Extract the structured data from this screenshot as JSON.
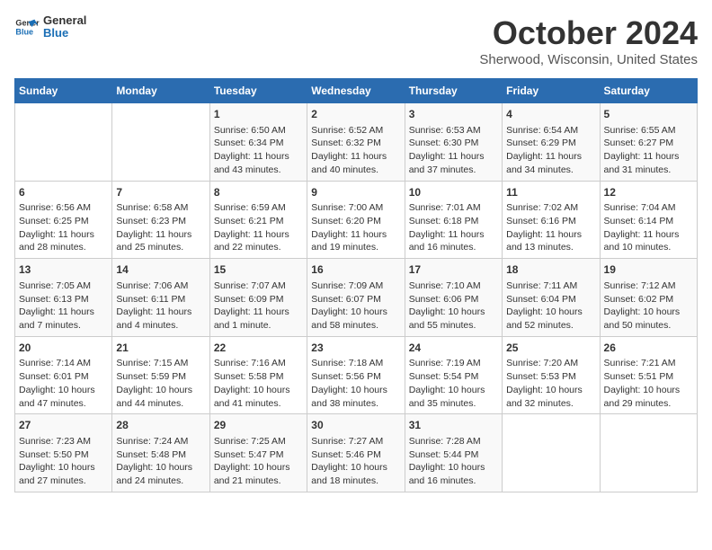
{
  "header": {
    "logo_line1": "General",
    "logo_line2": "Blue",
    "month": "October 2024",
    "location": "Sherwood, Wisconsin, United States"
  },
  "weekdays": [
    "Sunday",
    "Monday",
    "Tuesday",
    "Wednesday",
    "Thursday",
    "Friday",
    "Saturday"
  ],
  "weeks": [
    [
      {
        "day": "",
        "info": ""
      },
      {
        "day": "",
        "info": ""
      },
      {
        "day": "1",
        "info": "Sunrise: 6:50 AM\nSunset: 6:34 PM\nDaylight: 11 hours and 43 minutes."
      },
      {
        "day": "2",
        "info": "Sunrise: 6:52 AM\nSunset: 6:32 PM\nDaylight: 11 hours and 40 minutes."
      },
      {
        "day": "3",
        "info": "Sunrise: 6:53 AM\nSunset: 6:30 PM\nDaylight: 11 hours and 37 minutes."
      },
      {
        "day": "4",
        "info": "Sunrise: 6:54 AM\nSunset: 6:29 PM\nDaylight: 11 hours and 34 minutes."
      },
      {
        "day": "5",
        "info": "Sunrise: 6:55 AM\nSunset: 6:27 PM\nDaylight: 11 hours and 31 minutes."
      }
    ],
    [
      {
        "day": "6",
        "info": "Sunrise: 6:56 AM\nSunset: 6:25 PM\nDaylight: 11 hours and 28 minutes."
      },
      {
        "day": "7",
        "info": "Sunrise: 6:58 AM\nSunset: 6:23 PM\nDaylight: 11 hours and 25 minutes."
      },
      {
        "day": "8",
        "info": "Sunrise: 6:59 AM\nSunset: 6:21 PM\nDaylight: 11 hours and 22 minutes."
      },
      {
        "day": "9",
        "info": "Sunrise: 7:00 AM\nSunset: 6:20 PM\nDaylight: 11 hours and 19 minutes."
      },
      {
        "day": "10",
        "info": "Sunrise: 7:01 AM\nSunset: 6:18 PM\nDaylight: 11 hours and 16 minutes."
      },
      {
        "day": "11",
        "info": "Sunrise: 7:02 AM\nSunset: 6:16 PM\nDaylight: 11 hours and 13 minutes."
      },
      {
        "day": "12",
        "info": "Sunrise: 7:04 AM\nSunset: 6:14 PM\nDaylight: 11 hours and 10 minutes."
      }
    ],
    [
      {
        "day": "13",
        "info": "Sunrise: 7:05 AM\nSunset: 6:13 PM\nDaylight: 11 hours and 7 minutes."
      },
      {
        "day": "14",
        "info": "Sunrise: 7:06 AM\nSunset: 6:11 PM\nDaylight: 11 hours and 4 minutes."
      },
      {
        "day": "15",
        "info": "Sunrise: 7:07 AM\nSunset: 6:09 PM\nDaylight: 11 hours and 1 minute."
      },
      {
        "day": "16",
        "info": "Sunrise: 7:09 AM\nSunset: 6:07 PM\nDaylight: 10 hours and 58 minutes."
      },
      {
        "day": "17",
        "info": "Sunrise: 7:10 AM\nSunset: 6:06 PM\nDaylight: 10 hours and 55 minutes."
      },
      {
        "day": "18",
        "info": "Sunrise: 7:11 AM\nSunset: 6:04 PM\nDaylight: 10 hours and 52 minutes."
      },
      {
        "day": "19",
        "info": "Sunrise: 7:12 AM\nSunset: 6:02 PM\nDaylight: 10 hours and 50 minutes."
      }
    ],
    [
      {
        "day": "20",
        "info": "Sunrise: 7:14 AM\nSunset: 6:01 PM\nDaylight: 10 hours and 47 minutes."
      },
      {
        "day": "21",
        "info": "Sunrise: 7:15 AM\nSunset: 5:59 PM\nDaylight: 10 hours and 44 minutes."
      },
      {
        "day": "22",
        "info": "Sunrise: 7:16 AM\nSunset: 5:58 PM\nDaylight: 10 hours and 41 minutes."
      },
      {
        "day": "23",
        "info": "Sunrise: 7:18 AM\nSunset: 5:56 PM\nDaylight: 10 hours and 38 minutes."
      },
      {
        "day": "24",
        "info": "Sunrise: 7:19 AM\nSunset: 5:54 PM\nDaylight: 10 hours and 35 minutes."
      },
      {
        "day": "25",
        "info": "Sunrise: 7:20 AM\nSunset: 5:53 PM\nDaylight: 10 hours and 32 minutes."
      },
      {
        "day": "26",
        "info": "Sunrise: 7:21 AM\nSunset: 5:51 PM\nDaylight: 10 hours and 29 minutes."
      }
    ],
    [
      {
        "day": "27",
        "info": "Sunrise: 7:23 AM\nSunset: 5:50 PM\nDaylight: 10 hours and 27 minutes."
      },
      {
        "day": "28",
        "info": "Sunrise: 7:24 AM\nSunset: 5:48 PM\nDaylight: 10 hours and 24 minutes."
      },
      {
        "day": "29",
        "info": "Sunrise: 7:25 AM\nSunset: 5:47 PM\nDaylight: 10 hours and 21 minutes."
      },
      {
        "day": "30",
        "info": "Sunrise: 7:27 AM\nSunset: 5:46 PM\nDaylight: 10 hours and 18 minutes."
      },
      {
        "day": "31",
        "info": "Sunrise: 7:28 AM\nSunset: 5:44 PM\nDaylight: 10 hours and 16 minutes."
      },
      {
        "day": "",
        "info": ""
      },
      {
        "day": "",
        "info": ""
      }
    ]
  ]
}
